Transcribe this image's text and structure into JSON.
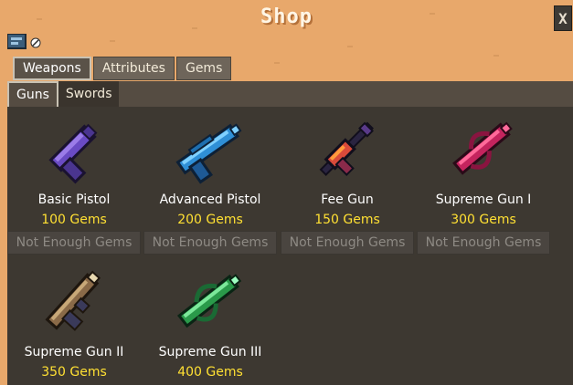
{
  "title": "Shop",
  "close_label": "X",
  "tabs": [
    {
      "label": "Weapons",
      "active": true
    },
    {
      "label": "Attributes",
      "active": false
    },
    {
      "label": "Gems",
      "active": false
    }
  ],
  "subtabs": [
    {
      "label": "Guns",
      "active": true
    },
    {
      "label": "Swords",
      "active": false
    }
  ],
  "items": [
    {
      "name": "Basic Pistol",
      "price": "100 Gems",
      "button": "Not Enough Gems",
      "icon": "basic-pistol-icon"
    },
    {
      "name": "Advanced Pistol",
      "price": "200 Gems",
      "button": "Not Enough Gems",
      "icon": "advanced-pistol-icon"
    },
    {
      "name": "Fee Gun",
      "price": "150 Gems",
      "button": "Not Enough Gems",
      "icon": "fee-gun-icon"
    },
    {
      "name": "Supreme Gun I",
      "price": "300 Gems",
      "button": "Not Enough Gems",
      "icon": "supreme-gun-1-icon"
    },
    {
      "name": "Supreme Gun II",
      "price": "350 Gems",
      "icon": "supreme-gun-2-icon"
    },
    {
      "name": "Supreme Gun III",
      "price": "400 Gems",
      "icon": "supreme-gun-3-icon"
    }
  ],
  "colors": {
    "sand": "#e8a86b",
    "panel": "#3d3831",
    "price": "#ffe033",
    "disabled_button": "#4a4540"
  }
}
